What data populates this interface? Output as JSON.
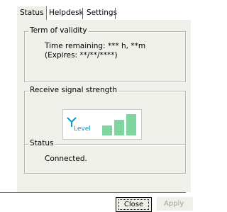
{
  "tabs": [
    {
      "label": "Status",
      "active": true
    },
    {
      "label": "Helpdesk",
      "active": false
    },
    {
      "label": "Settings",
      "active": false
    }
  ],
  "term_of_validity": {
    "legend": "Term of validity",
    "time_remaining": "Time remaining: *** h, **m",
    "expires": "(Expires: **/**/****)"
  },
  "signal": {
    "legend": "Receive signal strength",
    "level_label": "Level",
    "icon": "antenna-icon",
    "bars_active": 3,
    "bars_total": 3,
    "bar_color": "#7fd4a0",
    "level_color": "#0099cc"
  },
  "status": {
    "legend": "Status",
    "text": "Connected."
  },
  "buttons": {
    "close": "Close",
    "apply": "Apply"
  }
}
